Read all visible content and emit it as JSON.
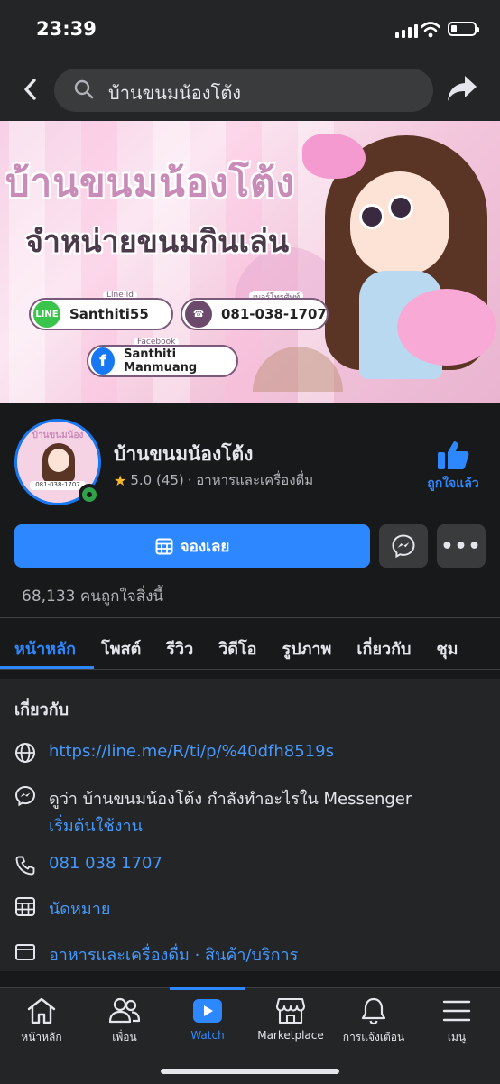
{
  "status_bar": {
    "time": "23:39"
  },
  "search": {
    "query": "บ้านขนมน้องโต้ง"
  },
  "cover": {
    "title": "บ้านขนมน้องโต้ง",
    "subtitle": "จำหน่ายขนมกินเล่น",
    "line_caption": "Line Id",
    "line_id": "Santhiti55",
    "phone_caption": "เบอร์โทรศัพท์",
    "phone": "081-038-1707",
    "facebook_caption": "Facebook",
    "facebook_name": "Santhiti Manmuang",
    "line_logo": "LINE"
  },
  "profile": {
    "name": "บ้านขนมน้องโต้ง",
    "rating": "5.0 (45)",
    "category": "· อาหารและเครื่องดื่ม",
    "liked_label": "ถูกใจแล้ว",
    "avatar_title": "บ้านขนมน้องโต้ง",
    "avatar_phone": "081-038-1707"
  },
  "actions": {
    "book_label": "จองเลย"
  },
  "likes_text": "68,133 คนถูกใจสิ่งนี้",
  "tabs": [
    "หน้าหลัก",
    "โพสต์",
    "รีวิว",
    "วิดีโอ",
    "รูปภาพ",
    "เกี่ยวกับ",
    "ชุม"
  ],
  "about": {
    "title": "เกี่ยวกับ",
    "website": "https://line.me/R/ti/p/%40dfh8519s",
    "messenger_text": "ดูว่า บ้านขนมน้องโต้ง กำลังทำอะไรใน Messenger",
    "messenger_link": "เริ่มต้นใช้งาน",
    "phone": "081 038 1707",
    "appointment": "นัดหมาย",
    "categories": "อาหารและเครื่องดื่ม · สินค้า/บริการ"
  },
  "bottom_nav": [
    {
      "label": "หน้าหลัก",
      "icon": "home-icon"
    },
    {
      "label": "เพื่อน",
      "icon": "friends-icon"
    },
    {
      "label": "Watch",
      "icon": "watch-icon",
      "active": true
    },
    {
      "label": "Marketplace",
      "icon": "marketplace-icon"
    },
    {
      "label": "การแจ้งเตือน",
      "icon": "bell-icon"
    },
    {
      "label": "เมนู",
      "icon": "menu-icon"
    }
  ],
  "colors": {
    "accent": "#2d88ff",
    "background": "#18191a",
    "surface": "#242526",
    "online": "#31a24c"
  }
}
